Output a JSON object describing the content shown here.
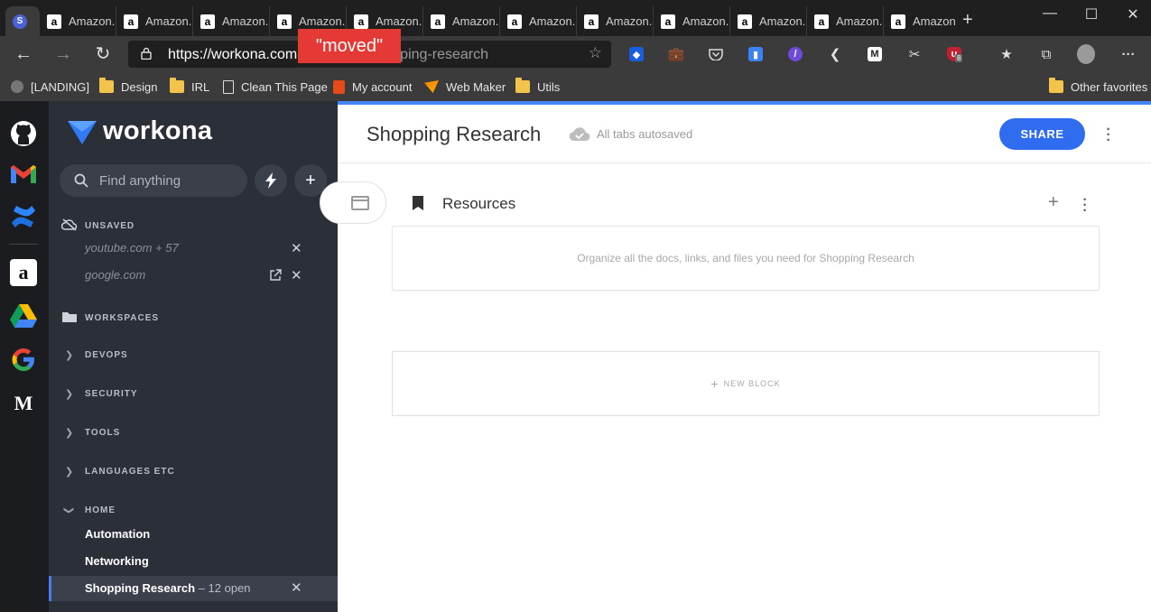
{
  "browser": {
    "tabs": [
      {
        "label": "",
        "favicon": "workona-favicon"
      },
      {
        "label": "Amazon.",
        "favicon": "amazon-favicon"
      },
      {
        "label": "Amazon.",
        "favicon": "amazon-favicon"
      },
      {
        "label": "Amazon.",
        "favicon": "amazon-favicon"
      },
      {
        "label": "Amazon.",
        "favicon": "amazon-favicon"
      },
      {
        "label": "Amazon.",
        "favicon": "amazon-favicon"
      },
      {
        "label": "Amazon.",
        "favicon": "amazon-favicon"
      },
      {
        "label": "Amazon.",
        "favicon": "amazon-favicon"
      },
      {
        "label": "Amazon.",
        "favicon": "amazon-favicon"
      },
      {
        "label": "Amazon.",
        "favicon": "amazon-favicon"
      },
      {
        "label": "Amazon.",
        "favicon": "amazon-favicon"
      },
      {
        "label": "Amazon.",
        "favicon": "amazon-favicon"
      },
      {
        "label": "Amazon.",
        "favicon": "amazon-favicon"
      }
    ],
    "url_visible": "https://workona.com",
    "url_faded": "ping-research",
    "overlay_label": "\"moved\"",
    "extension_badge": "8",
    "bookmarks": [
      {
        "label": "[LANDING]",
        "icon": "landing-icon"
      },
      {
        "label": "Design",
        "icon": "folder-icon"
      },
      {
        "label": "IRL",
        "icon": "folder-icon"
      },
      {
        "label": "Clean This Page",
        "icon": "page-icon"
      },
      {
        "label": "My account",
        "icon": "office-icon"
      },
      {
        "label": "Web Maker",
        "icon": "webmaker-icon"
      },
      {
        "label": "Utils",
        "icon": "folder-icon"
      }
    ],
    "other_favorites": "Other favorites",
    "accent_color": "#4285f4"
  },
  "rail": {
    "apps": [
      "github-icon",
      "gmail-icon",
      "confluence-icon",
      "amazon-icon",
      "google-drive-icon",
      "google-icon",
      "medium-icon"
    ]
  },
  "sidebar": {
    "logo_text": "workona",
    "search_placeholder": "Find anything",
    "unsaved_heading": "UNSAVED",
    "unsaved_items": [
      "youtube.com + 57",
      "google.com"
    ],
    "workspaces_heading": "WORKSPACES",
    "groups": [
      "DEVOPS",
      "SECURITY",
      "TOOLS",
      "LANGUAGES ETC",
      "HOME"
    ],
    "home_items": [
      "Automation",
      "Networking"
    ],
    "active_workspace": "Shopping Research",
    "active_count": " – 12 open",
    "bg_color": "#2b2f38"
  },
  "main": {
    "title": "Shopping Research",
    "autosave": "All tabs autosaved",
    "share_label": "SHARE",
    "resources_title": "Resources",
    "resources_hint": "Organize all the docs, links, and files you need for Shopping Research",
    "new_block_label": "NEW BLOCK",
    "share_color": "#2f6cf0"
  }
}
